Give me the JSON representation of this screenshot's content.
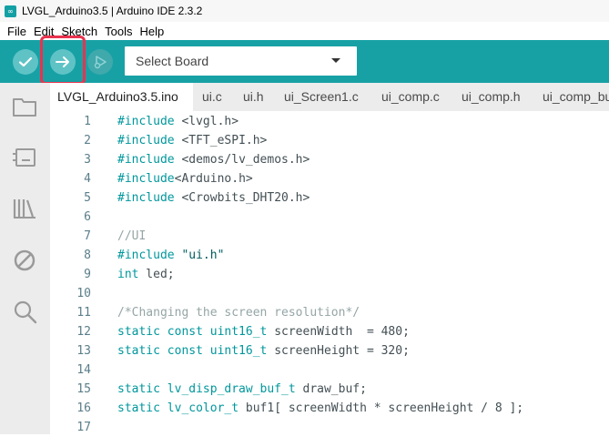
{
  "window": {
    "title": "LVGL_Arduino3.5 | Arduino IDE 2.3.2",
    "icon": "arduino-logo-icon",
    "accent": "#17a1a5"
  },
  "menu": [
    "File",
    "Edit",
    "Sketch",
    "Tools",
    "Help"
  ],
  "toolbar": {
    "board_select": "Select Board"
  },
  "sidebar": [
    "folder-icon",
    "board-manager-icon",
    "library-icon",
    "debug-icon",
    "search-icon"
  ],
  "tabs": [
    "LVGL_Arduino3.5.ino",
    "ui.c",
    "ui.h",
    "ui_Screen1.c",
    "ui_comp.c",
    "ui_comp.h",
    "ui_comp_bu"
  ],
  "lines": [
    {
      "n": "1",
      "parts": [
        {
          "t": "#include",
          "c": "kw"
        },
        {
          "t": " <lvgl.h>",
          "c": ""
        }
      ]
    },
    {
      "n": "2",
      "parts": [
        {
          "t": "#include",
          "c": "kw"
        },
        {
          "t": " <TFT_eSPI.h>",
          "c": ""
        }
      ]
    },
    {
      "n": "3",
      "parts": [
        {
          "t": "#include",
          "c": "kw"
        },
        {
          "t": " <demos/lv_demos.h>",
          "c": ""
        }
      ]
    },
    {
      "n": "4",
      "parts": [
        {
          "t": "#include",
          "c": "kw"
        },
        {
          "t": "<Arduino.h>",
          "c": ""
        }
      ]
    },
    {
      "n": "5",
      "parts": [
        {
          "t": "#include",
          "c": "kw"
        },
        {
          "t": " <Crowbits_DHT20.h>",
          "c": ""
        }
      ]
    },
    {
      "n": "6",
      "parts": []
    },
    {
      "n": "7",
      "parts": [
        {
          "t": "//UI",
          "c": "cmt"
        }
      ]
    },
    {
      "n": "8",
      "parts": [
        {
          "t": "#include",
          "c": "kw"
        },
        {
          "t": " \"ui.h\"",
          "c": "str"
        }
      ]
    },
    {
      "n": "9",
      "parts": [
        {
          "t": "int",
          "c": "kw"
        },
        {
          "t": " led;",
          "c": ""
        }
      ]
    },
    {
      "n": "10",
      "parts": []
    },
    {
      "n": "11",
      "parts": [
        {
          "t": "/*Changing the screen resolution*/",
          "c": "cmt"
        }
      ]
    },
    {
      "n": "12",
      "parts": [
        {
          "t": "static const uint16_t",
          "c": "kw"
        },
        {
          "t": " screenWidth  = 480;",
          "c": ""
        }
      ]
    },
    {
      "n": "13",
      "parts": [
        {
          "t": "static const uint16_t",
          "c": "kw"
        },
        {
          "t": " screenHeight = 320;",
          "c": ""
        }
      ]
    },
    {
      "n": "14",
      "parts": []
    },
    {
      "n": "15",
      "parts": [
        {
          "t": "static lv_disp_draw_buf_t",
          "c": "kw"
        },
        {
          "t": " draw_buf;",
          "c": ""
        }
      ]
    },
    {
      "n": "16",
      "parts": [
        {
          "t": "static lv_color_t",
          "c": "kw"
        },
        {
          "t": " buf1[ screenWidth * screenHeight / 8 ];",
          "c": ""
        }
      ]
    },
    {
      "n": "17",
      "parts": []
    }
  ]
}
